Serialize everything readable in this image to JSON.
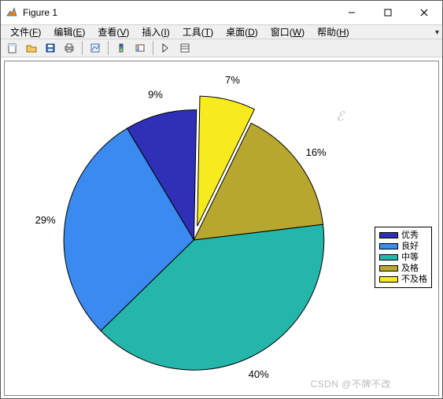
{
  "titlebar": {
    "title": "Figure 1"
  },
  "menubar": {
    "items": [
      {
        "label": "文件",
        "accel": "F"
      },
      {
        "label": "编辑",
        "accel": "E"
      },
      {
        "label": "查看",
        "accel": "V"
      },
      {
        "label": "插入",
        "accel": "I"
      },
      {
        "label": "工具",
        "accel": "T"
      },
      {
        "label": "桌面",
        "accel": "D"
      },
      {
        "label": "窗口",
        "accel": "W"
      },
      {
        "label": "帮助",
        "accel": "H"
      }
    ]
  },
  "watermark": "CSDN @不牌不改",
  "chart_data": {
    "type": "pie",
    "exploded_index": 4,
    "series": [
      {
        "name": "优秀",
        "value": 9,
        "pct_label": "9%",
        "color": "#2f2fb7"
      },
      {
        "name": "良好",
        "value": 29,
        "pct_label": "29%",
        "color": "#3a8af0"
      },
      {
        "name": "中等",
        "value": 40,
        "pct_label": "40%",
        "color": "#25b6ab"
      },
      {
        "name": "及格",
        "value": 16,
        "pct_label": "16%",
        "color": "#b8a72e"
      },
      {
        "name": "不及格",
        "value": 7,
        "pct_label": "7%",
        "color": "#f7ea1e"
      }
    ],
    "title": "",
    "legend_position": "right"
  }
}
